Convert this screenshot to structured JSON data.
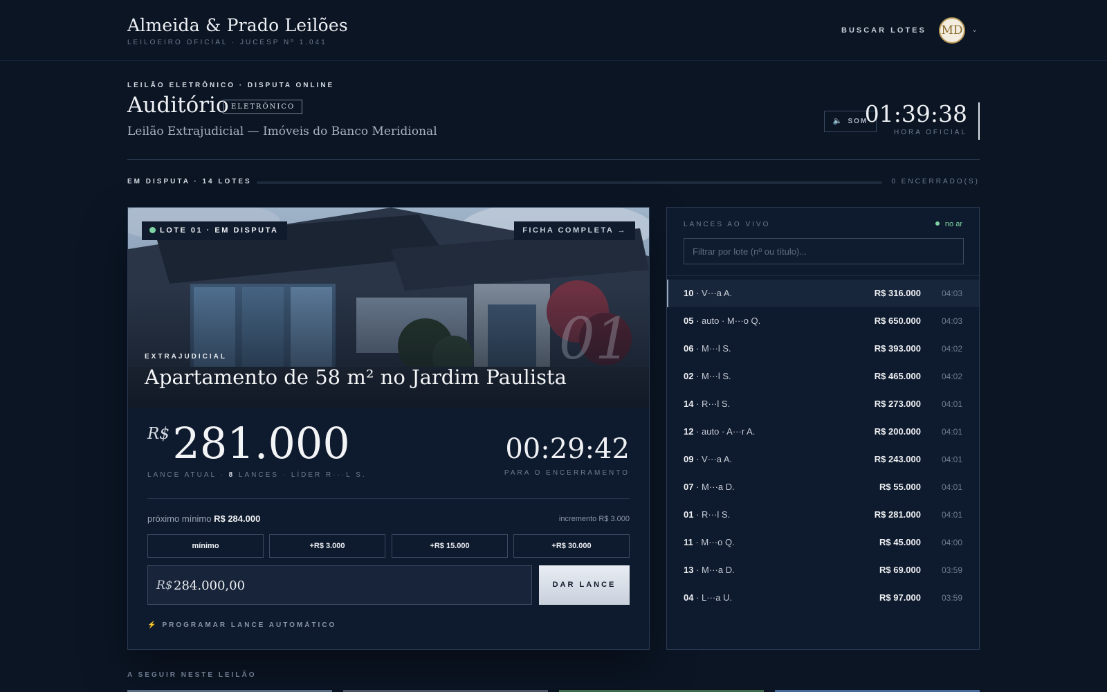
{
  "header": {
    "brand_name": "Almeida & Prado Leilões",
    "brand_sub": "LEILOEIRO OFICIAL · JUCESP Nº 1.041",
    "nav_search": "BUSCAR LOTES",
    "avatar_initials": "MD"
  },
  "auditorium": {
    "kicker": "LEILÃO ELETRÔNICO · DISPUTA ONLINE",
    "title": "Auditório",
    "tag": "ELETRÔNICO",
    "subtitle": "Leilão Extrajudicial — Imóveis do Banco Meridional",
    "sound_label": "SOM",
    "clock_time": "01:39:38",
    "clock_label": "HORA OFICIAL"
  },
  "progress": {
    "left_label": "EM DISPUTA · 14 LOTES",
    "right_label": "0 ENCERRADO(S)",
    "fraction": 0
  },
  "lot": {
    "badge": "LOTE 01 · EM DISPUTA",
    "ficha": "FICHA COMPLETA →",
    "number": "01",
    "type": "EXTRAJUDICIAL",
    "title": "Apartamento de 58 m² no Jardim Paulista",
    "currency": "R$",
    "current_bid": "281.000",
    "meta_prefix": "LANCE ATUAL · ",
    "meta_count": "8",
    "meta_suffix": " LANCES · LÍDER R···L S.",
    "countdown": "00:29:42",
    "countdown_label": "PARA O ENCERRAMENTO",
    "next_min_label": "próximo mínimo",
    "next_min_value": "R$ 284.000",
    "increment": "incremento R$ 3.000",
    "quick_bids": [
      "mínimo",
      "+R$ 3.000",
      "+R$ 15.000",
      "+R$ 30.000"
    ],
    "input_currency": "R$",
    "input_value": "284.000,00",
    "bid_button": "DAR LANCE",
    "auto_bid": "PROGRAMAR LANCE AUTOMÁTICO"
  },
  "live": {
    "heading": "LANCES AO VIVO",
    "status": "no ar",
    "filter_placeholder": "Filtrar por lote (nº ou título)...",
    "bids": [
      {
        "lot": "10",
        "bidder": "V···a A.",
        "amount": "R$ 316.000",
        "time": "04:03",
        "active": true
      },
      {
        "lot": "05",
        "bidder": "auto · M···o Q.",
        "amount": "R$ 650.000",
        "time": "04:03"
      },
      {
        "lot": "06",
        "bidder": "M···l S.",
        "amount": "R$ 393.000",
        "time": "04:02"
      },
      {
        "lot": "02",
        "bidder": "M···l S.",
        "amount": "R$ 465.000",
        "time": "04:02"
      },
      {
        "lot": "14",
        "bidder": "R···l S.",
        "amount": "R$ 273.000",
        "time": "04:01"
      },
      {
        "lot": "12",
        "bidder": "auto · A···r A.",
        "amount": "R$ 200.000",
        "time": "04:01"
      },
      {
        "lot": "09",
        "bidder": "V···a A.",
        "amount": "R$ 243.000",
        "time": "04:01"
      },
      {
        "lot": "07",
        "bidder": "M···a D.",
        "amount": "R$ 55.000",
        "time": "04:01"
      },
      {
        "lot": "01",
        "bidder": "R···l S.",
        "amount": "R$ 281.000",
        "time": "04:01"
      },
      {
        "lot": "11",
        "bidder": "M···o Q.",
        "amount": "R$ 45.000",
        "time": "04:00"
      },
      {
        "lot": "13",
        "bidder": "M···a D.",
        "amount": "R$ 69.000",
        "time": "03:59"
      },
      {
        "lot": "04",
        "bidder": "L···a U.",
        "amount": "R$ 97.000",
        "time": "03:59"
      }
    ]
  },
  "upcoming": {
    "label": "A SEGUIR NESTE LEILÃO"
  },
  "colors": {
    "background": "#0b1524",
    "card": "#0e1a2d",
    "live_green": "#7fd3a2",
    "mute_red": "#d25c5c",
    "bolt_gold": "#d9b34a"
  },
  "icons": {
    "sound": "speaker-muted-icon",
    "avatar_menu": "chevron-down-icon",
    "auto_bid": "lightning-icon"
  }
}
